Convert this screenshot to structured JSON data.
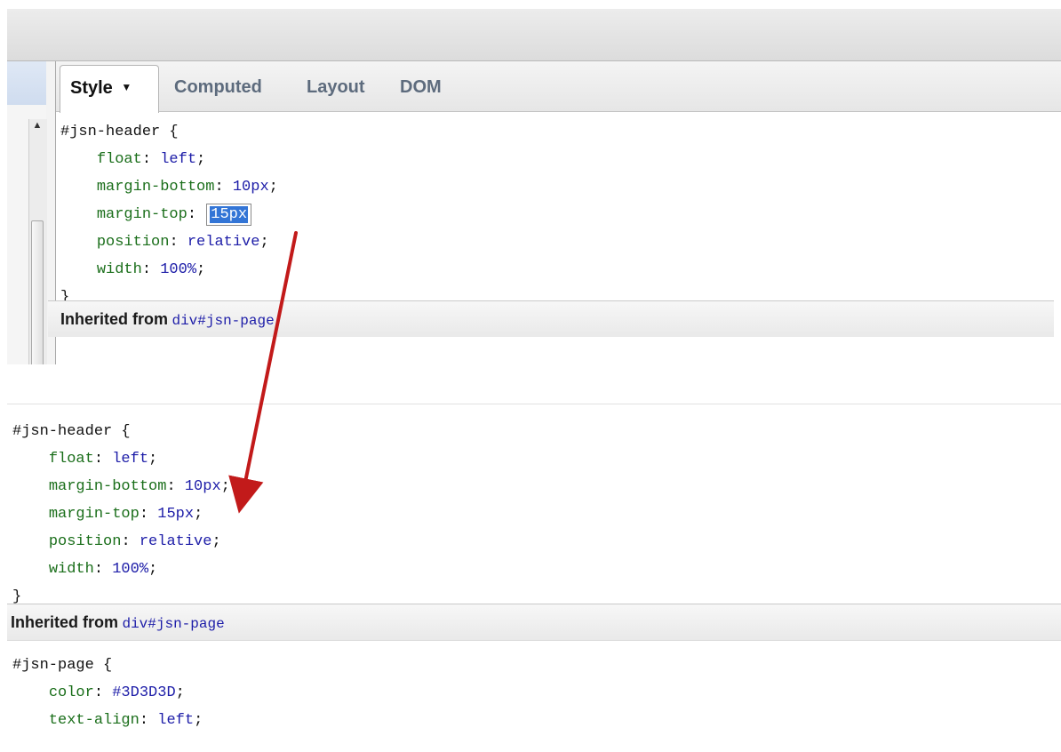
{
  "top": {
    "tabs": [
      {
        "label": "Style",
        "dropdown_icon": "▼"
      },
      {
        "label": "Computed"
      },
      {
        "label": "Layout"
      },
      {
        "label": "DOM"
      }
    ],
    "scroll_up_icon": "▲",
    "rule": {
      "selector": "#jsn-header",
      "open_brace": "{",
      "close_brace": "}",
      "declarations": [
        {
          "prop": "float",
          "value": "left"
        },
        {
          "prop": "margin-bottom",
          "value": "10px"
        },
        {
          "prop": "margin-top",
          "value": "15px",
          "editing": true
        },
        {
          "prop": "position",
          "value": "relative"
        },
        {
          "prop": "width",
          "value": "100%"
        }
      ]
    },
    "inherited": {
      "label": "Inherited from",
      "link": "div#jsn-page"
    }
  },
  "bottom": {
    "rule": {
      "selector": "#jsn-header",
      "open_brace": "{",
      "close_brace": "}",
      "declarations": [
        {
          "prop": "float",
          "value": "left"
        },
        {
          "prop": "margin-bottom",
          "value": "10px"
        },
        {
          "prop": "margin-top",
          "value": "15px"
        },
        {
          "prop": "position",
          "value": "relative"
        },
        {
          "prop": "width",
          "value": "100%"
        }
      ]
    },
    "inherited": {
      "label": "Inherited from",
      "link": "div#jsn-page"
    },
    "page_rule": {
      "selector": "#jsn-page",
      "open_brace": "{",
      "declarations": [
        {
          "prop": "color",
          "value": "#3D3D3D"
        },
        {
          "prop": "text-align",
          "value": "left"
        }
      ]
    }
  },
  "colors": {
    "selector": "#111111",
    "property": "#1a6e1a",
    "value": "#1d1da8",
    "selection": "#3375d6",
    "arrow": "#c21a1a"
  }
}
